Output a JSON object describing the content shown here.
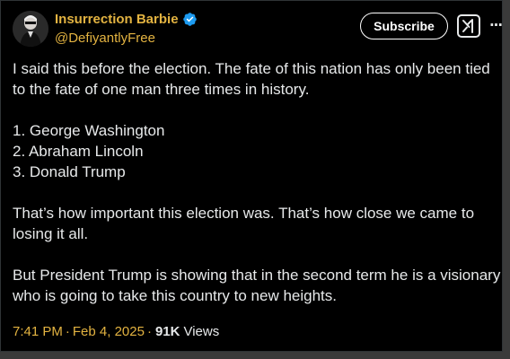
{
  "author": {
    "display_name": "Insurrection Barbie",
    "handle": "@DefiyantlyFree",
    "verified_icon": "verified-badge-icon",
    "accent_color": "#e3b341"
  },
  "actions": {
    "subscribe_label": "Subscribe",
    "grok_icon": "grok-icon",
    "more_icon": "more-icon",
    "more_label": "···"
  },
  "tweet": {
    "paragraph_1": "I said this before the election. The fate of this nation has only been tied to the fate of one man three times in history.",
    "list_item_1": "1. George Washington",
    "list_item_2": "2. Abraham Lincoln",
    "list_item_3": "3. Donald Trump",
    "paragraph_2": "That’s how important this election was. That’s how close we came to losing it all.",
    "paragraph_3": "But President Trump is showing that in the second term he is a visionary who is going to take this country to new heights."
  },
  "meta": {
    "time": "7:41 PM",
    "separator_1": "·",
    "date": "Feb 4, 2025",
    "separator_2": "·",
    "views_count": "91K",
    "views_label": "Views"
  },
  "colors": {
    "background": "#000000",
    "text": "#e7e9ea",
    "verified_blue": "#1d9bf0"
  }
}
